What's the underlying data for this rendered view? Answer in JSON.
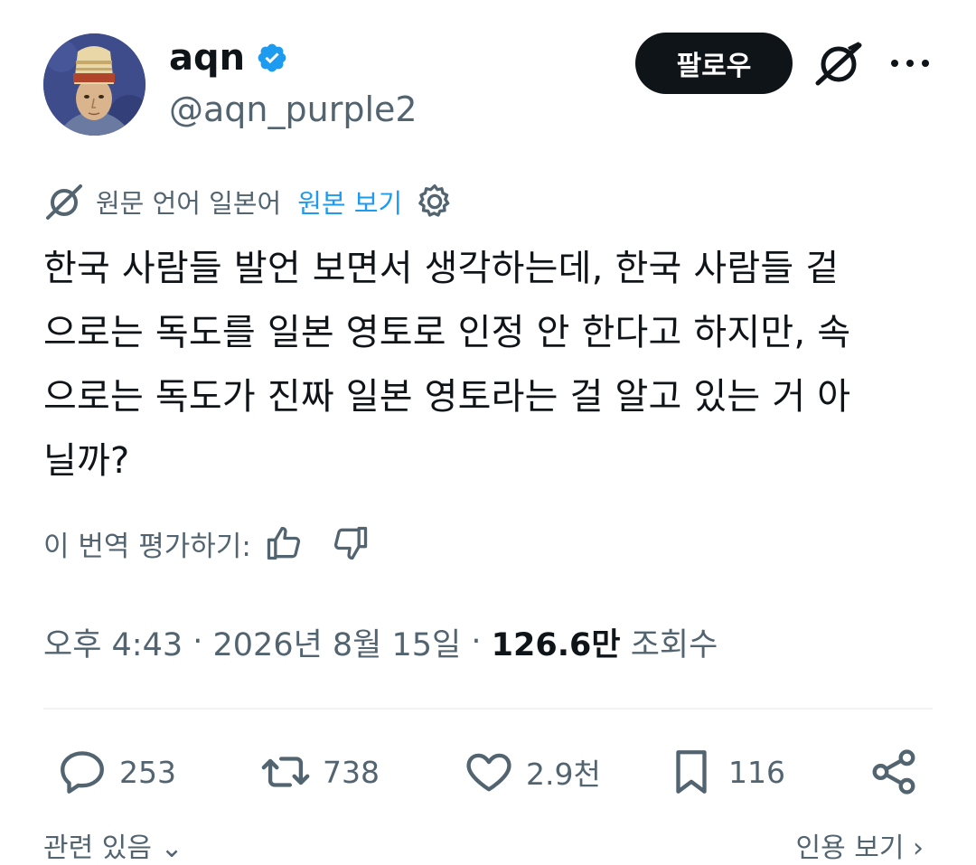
{
  "profile": {
    "display_name": "aqn",
    "handle": "@aqn_purple2",
    "verified": true,
    "avatar_icon": "avatar-painting-icon"
  },
  "header": {
    "follow_label": "팔로우",
    "grok_icon": "grok-icon",
    "more_icon": "more-dots-icon"
  },
  "translation": {
    "source_language_text": "원문 언어 일본어",
    "show_original_label": "원본 보기",
    "settings_icon": "gear-icon"
  },
  "tweet": {
    "text": "한국 사람들 발언 보면서 생각하는데, 한국 사람들 겉\n으로는 독도를 일본 영토로 인정 안 한다고 하지만, 속\n으로는 독도가 진짜 일본 영토라는 걸 알고 있는 거 아\n닐까?"
  },
  "rating": {
    "label": "이 번역 평가하기:",
    "up_icon": "thumbs-up-icon",
    "down_icon": "thumbs-down-icon"
  },
  "meta": {
    "time": "오후 4:43",
    "separator": " · ",
    "date": "2026년 8월 15일",
    "separator2": " · ",
    "views_count": "126.6만",
    "views_label": " 조회수"
  },
  "actions": {
    "replies": "253",
    "retweets": "738",
    "likes": "2.9천",
    "bookmarks": "116"
  },
  "bottom": {
    "left_text": "관련 있음",
    "right_text": "인용 보기"
  },
  "colors": {
    "text_primary": "#0f1419",
    "text_secondary": "#536471",
    "accent_blue": "#1d9bf0",
    "divider": "#eff3f4"
  }
}
